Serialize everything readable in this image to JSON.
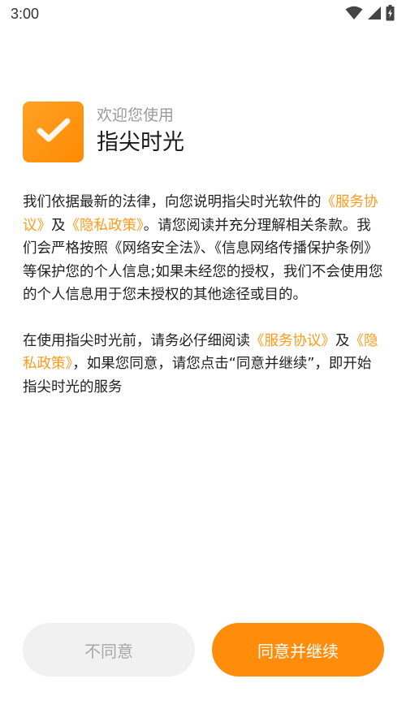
{
  "status_bar": {
    "time": "3:00",
    "icons": [
      "wifi-icon",
      "cell-signal-icon",
      "battery-charging-icon"
    ]
  },
  "header": {
    "logo_icon": "checkmark-icon",
    "welcome": "欢迎您使用",
    "app_name": "指尖时光"
  },
  "paragraph1": {
    "part1": "我们依据最新的法律，向您说明指尖时光软件的",
    "link_service": "《服务协议》",
    "part2": "及",
    "link_privacy": "《隐私政策》",
    "part3": "。请您阅读并充分理解相关条款。我们会严格按照《网络安全法》、《信息网络传播保护条例》等保护您的个人信息;如果未经您的授权，我们不会使用您的个人信息用于您未授权的其他途径或目的。"
  },
  "paragraph2": {
    "part1": "在使用指尖时光前，请务必仔细阅读",
    "link_service": "《服务协议》",
    "part2": "及",
    "link_privacy": "《隐私政策》",
    "part3": "，如果您同意，请您点击“同意并继续”，即开始指尖时光的服务"
  },
  "buttons": {
    "disagree_label": "不同意",
    "agree_label": "同意并继续"
  },
  "colors": {
    "accent": "#ff8c0a",
    "link": "#ff9a1a",
    "disabled_bg": "#f1f1f1",
    "disabled_text": "#a8a8a8"
  }
}
